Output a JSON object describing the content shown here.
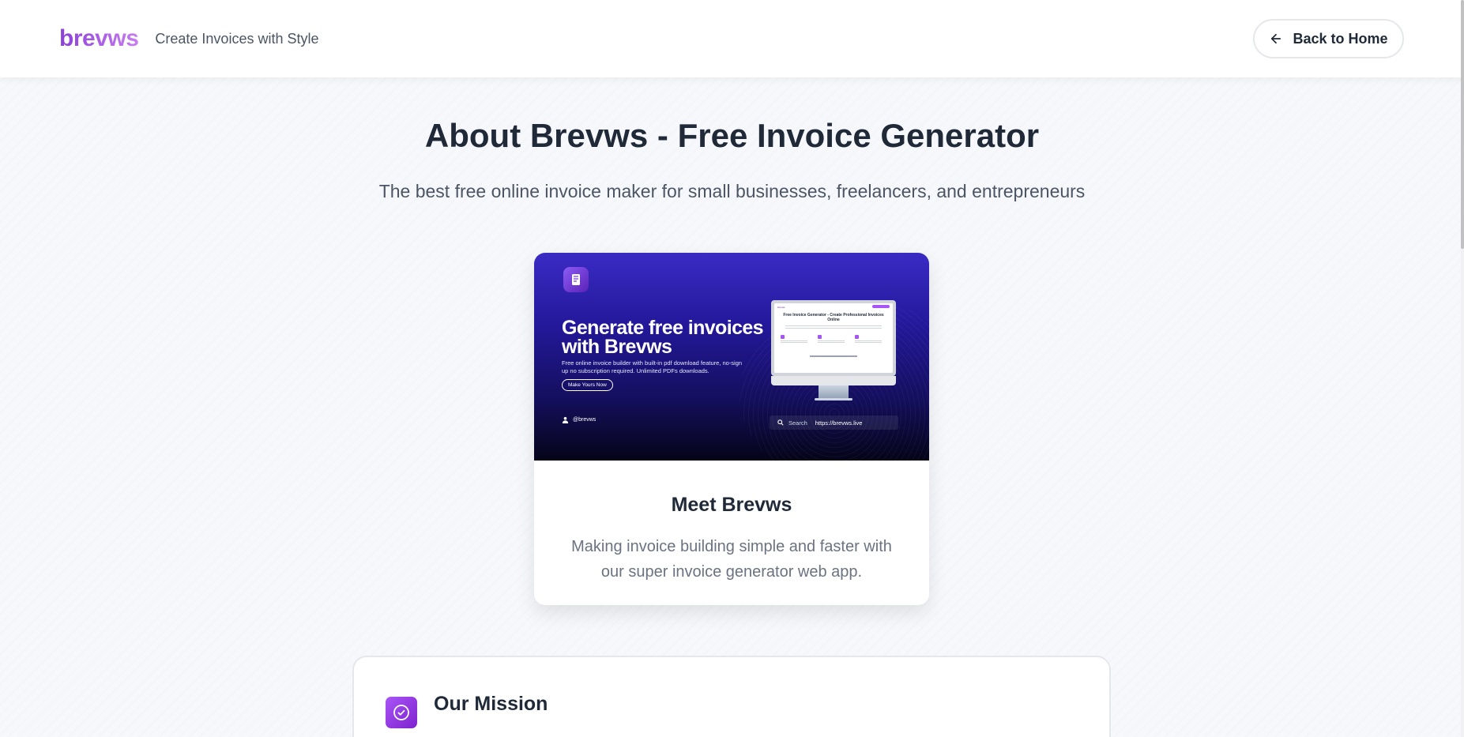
{
  "header": {
    "logo": "brevws",
    "tagline": "Create Invoices with Style",
    "back_label": "Back to Home"
  },
  "hero": {
    "title": "About Brevws - Free Invoice Generator",
    "subtitle": "The best free online invoice maker for small businesses, freelancers, and entrepreneurs"
  },
  "card": {
    "banner": {
      "headline": "Generate free invoices with Brevws",
      "blurb": "Free online invoice builder with built-in pdf download feature, no-sign up no subscription required. Unlimited PDFs downloads.",
      "cta": "Make Yours Now",
      "handle": "@brevws",
      "search_label": "Search",
      "search_url": "https://brevws.live",
      "screen_title": "Free Invoice Generator - Create Professional Invoices Online"
    },
    "title": "Meet Brevws",
    "text": "Making invoice building simple and faster with our super invoice generator web app."
  },
  "mission": {
    "title": "Our Mission"
  },
  "colors": {
    "brand_start": "#8b3fd9",
    "brand_end": "#c77ef0",
    "banner_top": "#3a2bc4",
    "banner_bottom": "#050418"
  }
}
